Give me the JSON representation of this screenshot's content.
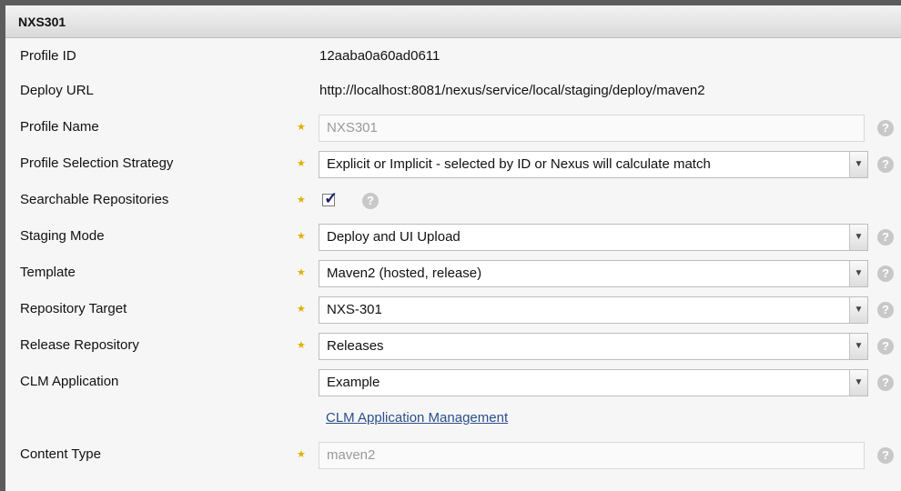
{
  "panel": {
    "title": "NXS301"
  },
  "profile_id": {
    "label": "Profile ID",
    "value": "12aaba0a60ad0611"
  },
  "deploy_url": {
    "label": "Deploy URL",
    "value": "http://localhost:8081/nexus/service/local/staging/deploy/maven2"
  },
  "profile_name": {
    "label": "Profile Name",
    "value": "NXS301"
  },
  "selection_strategy": {
    "label": "Profile Selection Strategy",
    "value": "Explicit or Implicit - selected by ID or Nexus will calculate match"
  },
  "searchable": {
    "label": "Searchable Repositories",
    "checked": true
  },
  "staging_mode": {
    "label": "Staging Mode",
    "value": "Deploy and UI Upload"
  },
  "template": {
    "label": "Template",
    "value": "Maven2 (hosted, release)"
  },
  "repository_target": {
    "label": "Repository Target",
    "value": "NXS-301"
  },
  "release_repository": {
    "label": "Release Repository",
    "value": "Releases"
  },
  "clm_application": {
    "label": "CLM Application",
    "value": "Example",
    "link": "CLM Application Management"
  },
  "content_type": {
    "label": "Content Type",
    "value": "maven2"
  },
  "colors": {
    "required_star": "#e0b000",
    "link": "#2a4f8a",
    "help_icon": "#c8c8c8"
  },
  "icons": {
    "required": "star-icon",
    "help": "help-icon",
    "dropdown": "chevron-down-icon",
    "check": "checkmark-icon"
  }
}
